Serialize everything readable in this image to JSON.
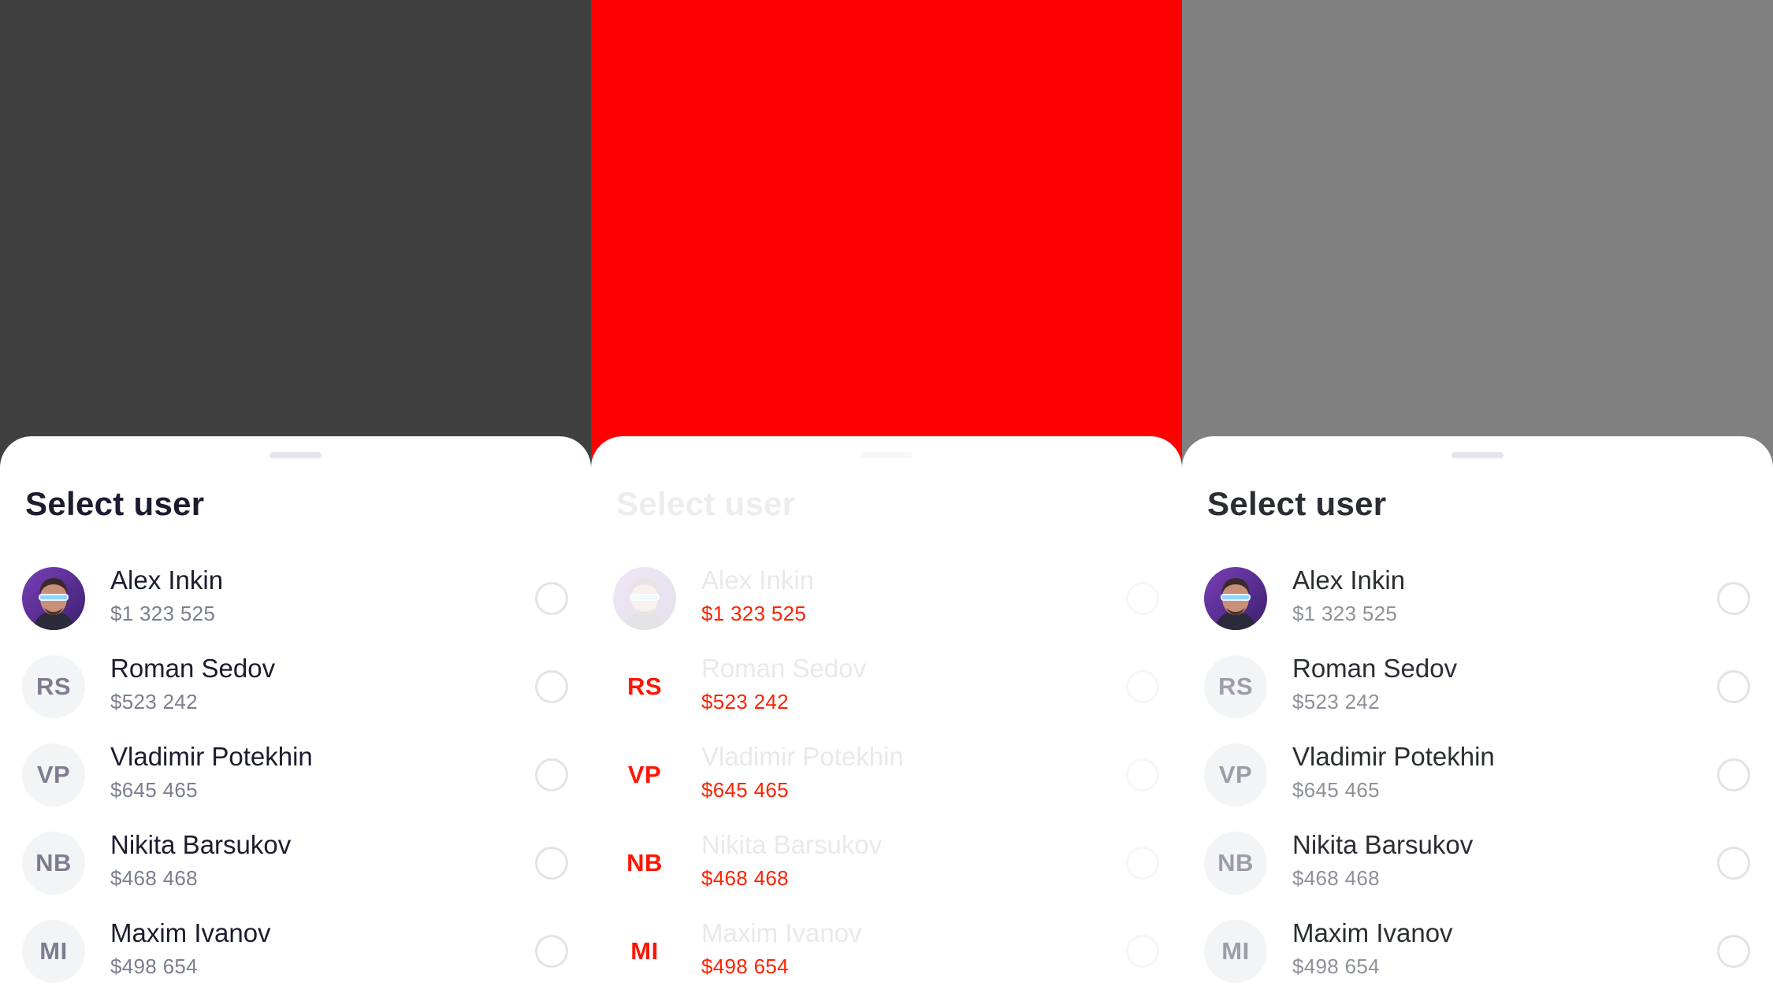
{
  "colors": {
    "panel_1_backdrop": "#404040",
    "panel_2_backdrop": "#ff0000",
    "panel_3_backdrop": "#808080",
    "title_text": "#1b1c30",
    "secondary_text": "#7b7e8f",
    "highlight_red": "#ff1500"
  },
  "sheet": {
    "title": "Select user"
  },
  "users": [
    {
      "name": "Alex Inkin",
      "amount": "$1 323 525",
      "initials": "",
      "avatar": "photo",
      "selected": false
    },
    {
      "name": "Roman Sedov",
      "amount": "$523 242",
      "initials": "RS",
      "avatar": "initials",
      "selected": false
    },
    {
      "name": "Vladimir Potekhin",
      "amount": "$645 465",
      "initials": "VP",
      "avatar": "initials",
      "selected": false
    },
    {
      "name": "Nikita Barsukov",
      "amount": "$468 468",
      "initials": "NB",
      "avatar": "initials",
      "selected": false
    },
    {
      "name": "Maxim Ivanov",
      "amount": "$498 654",
      "initials": "MI",
      "avatar": "initials",
      "selected": false
    }
  ]
}
